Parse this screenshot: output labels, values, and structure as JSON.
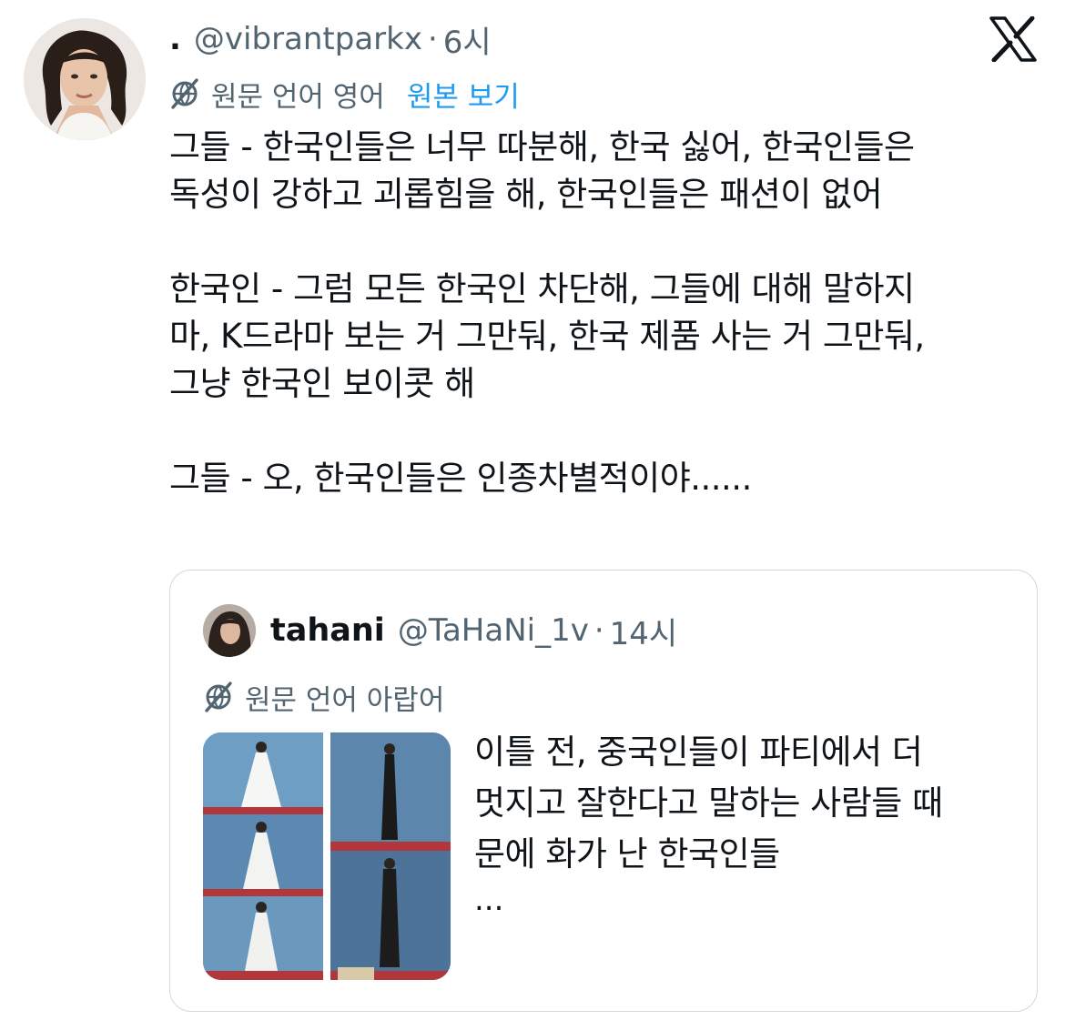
{
  "tweet": {
    "name_placeholder": ".",
    "handle": "@vibrantparkx",
    "separator": "·",
    "time": "6시",
    "translation_label": "원문 언어 영어",
    "show_original": "원본 보기",
    "text": "그들 - 한국인들은 너무 따분해, 한국 싫어, 한국인들은\n독성이 강하고 괴롭힘을 해, 한국인들은 패션이 없어\n\n한국인 - 그럼 모든 한국인 차단해, 그들에 대해 말하지\n마, K드라마 보는 거 그만둬, 한국 제품 사는 거 그만둬,\n그냥 한국인 보이콧 해\n\n그들 - 오, 한국인들은 인종차별적이야......"
  },
  "quote": {
    "name": "tahani",
    "handle": "@TaHaNi_1v",
    "separator": "·",
    "time": "14시",
    "translation_label": "원문 언어 아랍어",
    "text": "이틀 전, 중국인들이 파티에서 더\n멋지고 잘한다고 말하는 사람들 때\n문에 화가 난 한국인들",
    "ellipsis": "..."
  },
  "icons": {
    "brand": "x-logo-icon",
    "translate": "translate-globe-icon"
  },
  "colors": {
    "text": "#0f1419",
    "secondary": "#536471",
    "link": "#1d9bf0",
    "border": "#cfd9de"
  }
}
